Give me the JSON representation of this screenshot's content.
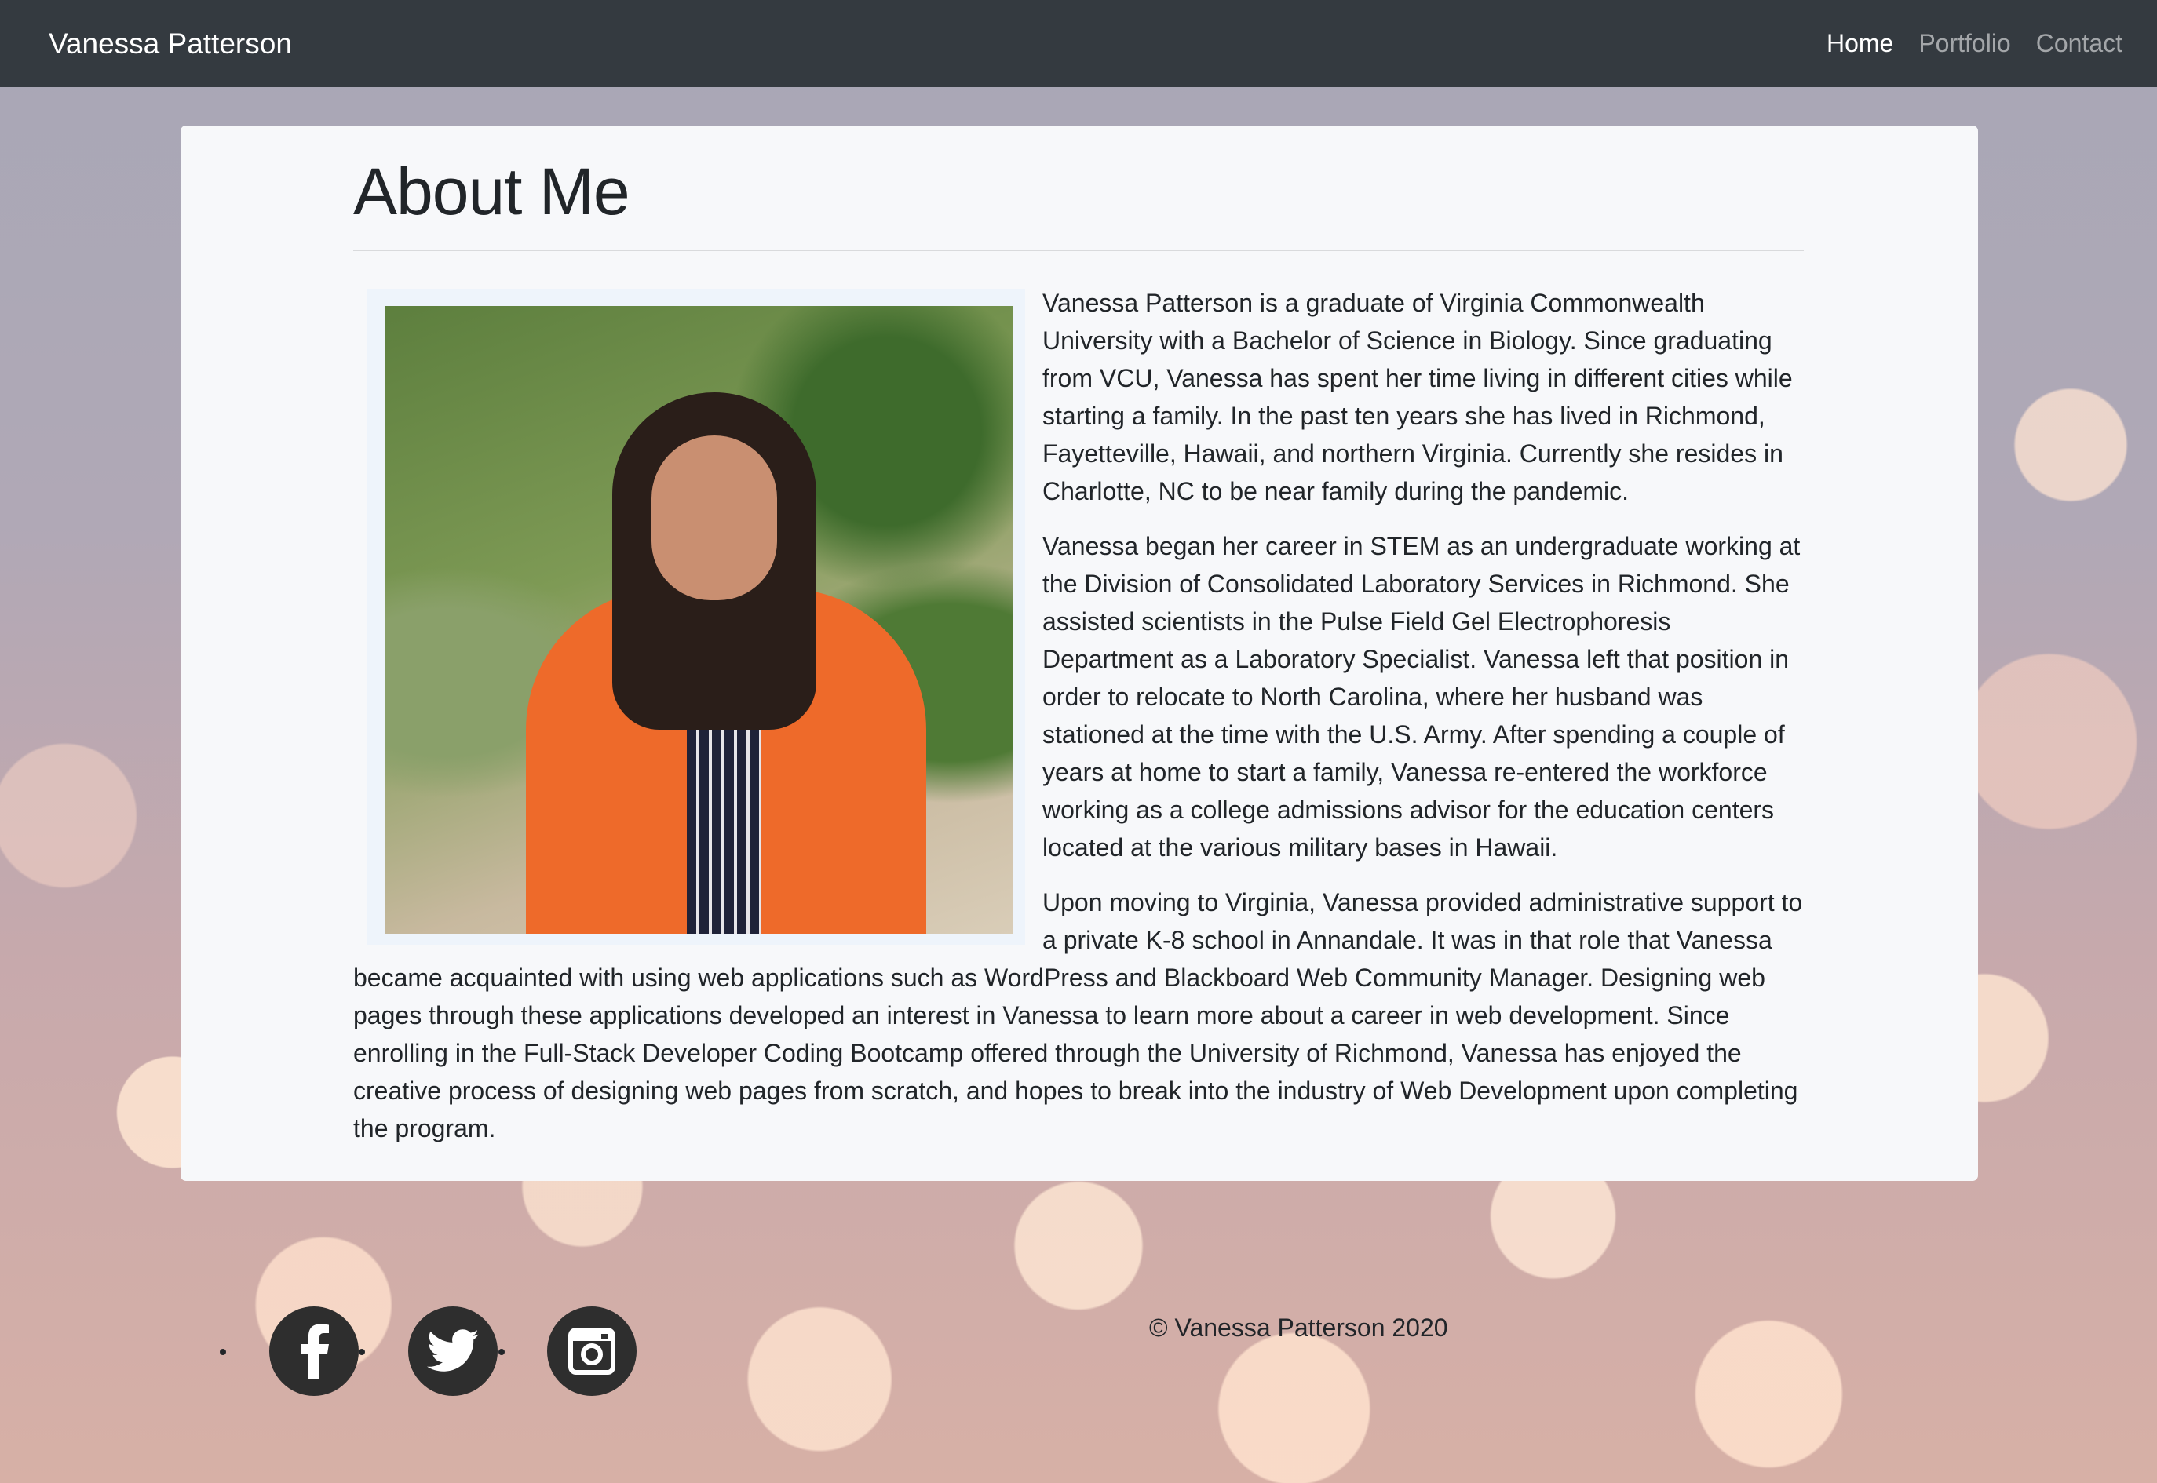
{
  "navbar": {
    "brand": "Vanessa Patterson",
    "links": [
      {
        "label": "Home",
        "active": true
      },
      {
        "label": "Portfolio",
        "active": false
      },
      {
        "label": "Contact",
        "active": false
      }
    ]
  },
  "about": {
    "title": "About Me",
    "paragraphs": [
      "Vanessa Patterson is a graduate of Virginia Commonwealth University with a Bachelor of Science in Biology. Since graduating from VCU, Vanessa has spent her time living in different cities while starting a family. In the past ten years she has lived in Richmond, Fayetteville, Hawaii, and northern Virginia. Currently she resides in Charlotte, NC to be near family during the pandemic.",
      "Vanessa began her career in STEM as an undergraduate working at the Division of Consolidated Laboratory Services in Richmond. She assisted scientists in the Pulse Field Gel Electrophoresis Department as a Laboratory Specialist. Vanessa left that position in order to relocate to North Carolina, where her husband was stationed at the time with the U.S. Army. After spending a couple of years at home to start a family, Vanessa re-entered the workforce working as a college admissions advisor for the education centers located at the various military bases in Hawaii.",
      "Upon moving to Virginia, Vanessa provided administrative support to a private K-8 school in Annandale. It was in that role that Vanessa became acquainted with using web applications such as WordPress and Blackboard Web Community Manager. Designing web pages through these applications developed an interest in Vanessa to learn more about a career in web development. Since enrolling in the Full-Stack Developer Coding Bootcamp offered through the University of Richmond, Vanessa has enjoyed the creative process of designing web pages from scratch, and hopes to break into the industry of Web Development upon completing the program."
    ]
  },
  "footer": {
    "socials": [
      "facebook-icon",
      "twitter-icon",
      "instagram-icon"
    ],
    "copyright": "© Vanessa Patterson 2020"
  }
}
